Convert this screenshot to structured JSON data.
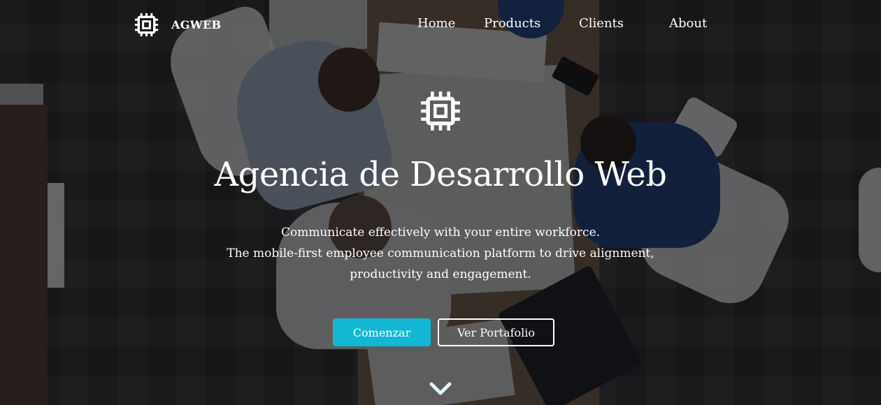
{
  "brand": {
    "name": "AGWEB",
    "icon": "chip-icon"
  },
  "nav": {
    "items": [
      {
        "label": "Home"
      },
      {
        "label": "Products"
      },
      {
        "label": "Clients"
      },
      {
        "label": "About"
      }
    ]
  },
  "hero": {
    "icon": "chip-icon",
    "title": "Agencia de Desarrollo Web",
    "subtitle_lines": [
      "Communicate effectively with your entire workforce.",
      "The mobile-first employee communication platform to drive alignment,",
      "productivity and engagement."
    ],
    "primary_button": "Comenzar",
    "secondary_button": "Ver Portafolio",
    "scroll_icon": "chevron-down-icon"
  },
  "colors": {
    "accent": "#12b8d2",
    "text": "#ffffff",
    "overlay": "rgba(10,10,12,0.55)"
  }
}
